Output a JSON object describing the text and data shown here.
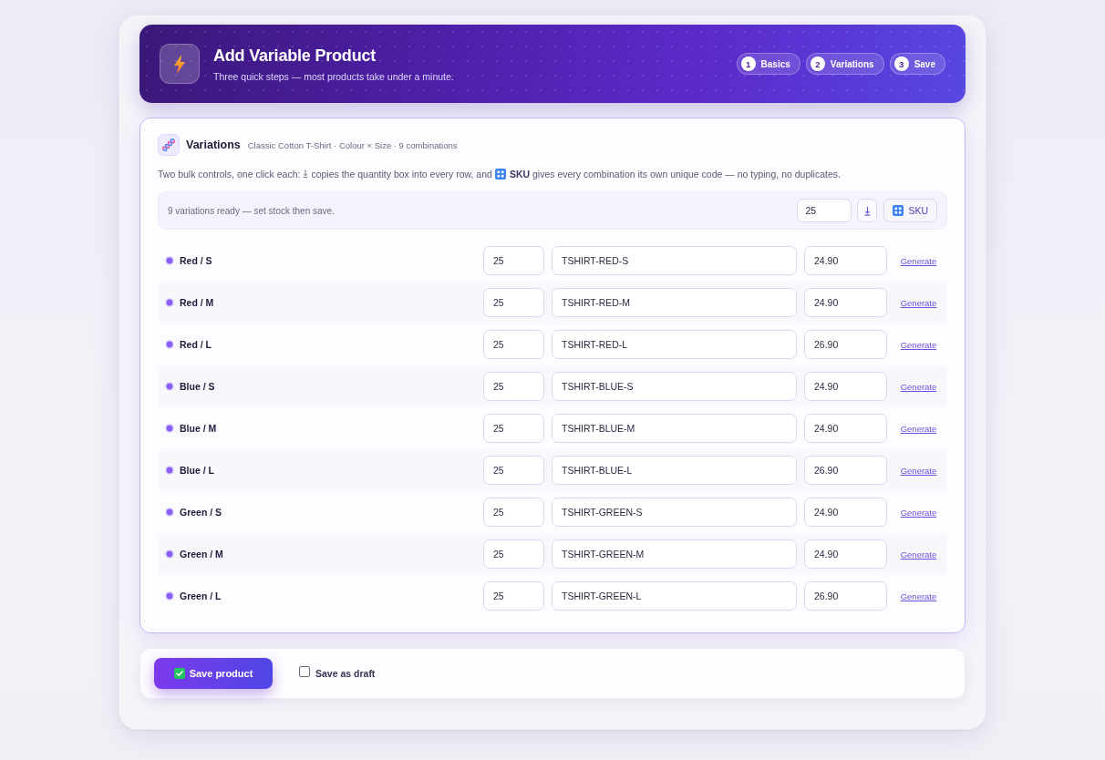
{
  "header": {
    "title": "Add Variable Product",
    "subtitle": "Three quick steps — most products take under a minute.",
    "steps": [
      {
        "number": "1",
        "label": "Basics"
      },
      {
        "number": "2",
        "label": "Variations"
      },
      {
        "number": "3",
        "label": "Save"
      }
    ]
  },
  "variations": {
    "title": "Variations",
    "subtitle": "Classic Cotton T-Shirt · Colour × Size · 9 combinations",
    "help": [
      "Two bulk controls, one click each:",
      "copies the quantity box into every row, and",
      "**SKU** gives every combination its own unique code — no typing, no duplicates."
    ],
    "toolbar": {
      "status": "9 variations ready — set stock then save.",
      "bulk_quantity": "25",
      "sku_button": "SKU"
    },
    "rows": [
      {
        "name": "Red / S",
        "quantity": "25",
        "sku": "TSHIRT-RED-S",
        "price": "24.90",
        "action": "Generate"
      },
      {
        "name": "Red / M",
        "quantity": "25",
        "sku": "TSHIRT-RED-M",
        "price": "24.90",
        "action": "Generate"
      },
      {
        "name": "Red / L",
        "quantity": "25",
        "sku": "TSHIRT-RED-L",
        "price": "26.90",
        "action": "Generate"
      },
      {
        "name": "Blue / S",
        "quantity": "25",
        "sku": "TSHIRT-BLUE-S",
        "price": "24.90",
        "action": "Generate"
      },
      {
        "name": "Blue / M",
        "quantity": "25",
        "sku": "TSHIRT-BLUE-M",
        "price": "24.90",
        "action": "Generate"
      },
      {
        "name": "Blue / L",
        "quantity": "25",
        "sku": "TSHIRT-BLUE-L",
        "price": "26.90",
        "action": "Generate"
      },
      {
        "name": "Green / S",
        "quantity": "25",
        "sku": "TSHIRT-GREEN-S",
        "price": "24.90",
        "action": "Generate"
      },
      {
        "name": "Green / M",
        "quantity": "25",
        "sku": "TSHIRT-GREEN-M",
        "price": "24.90",
        "action": "Generate"
      },
      {
        "name": "Green / L",
        "quantity": "25",
        "sku": "TSHIRT-GREEN-L",
        "price": "26.90",
        "action": "Generate"
      }
    ]
  },
  "footer": {
    "save_button": "Save product",
    "draft": {
      "label": "Save as draft",
      "checked": false
    }
  }
}
